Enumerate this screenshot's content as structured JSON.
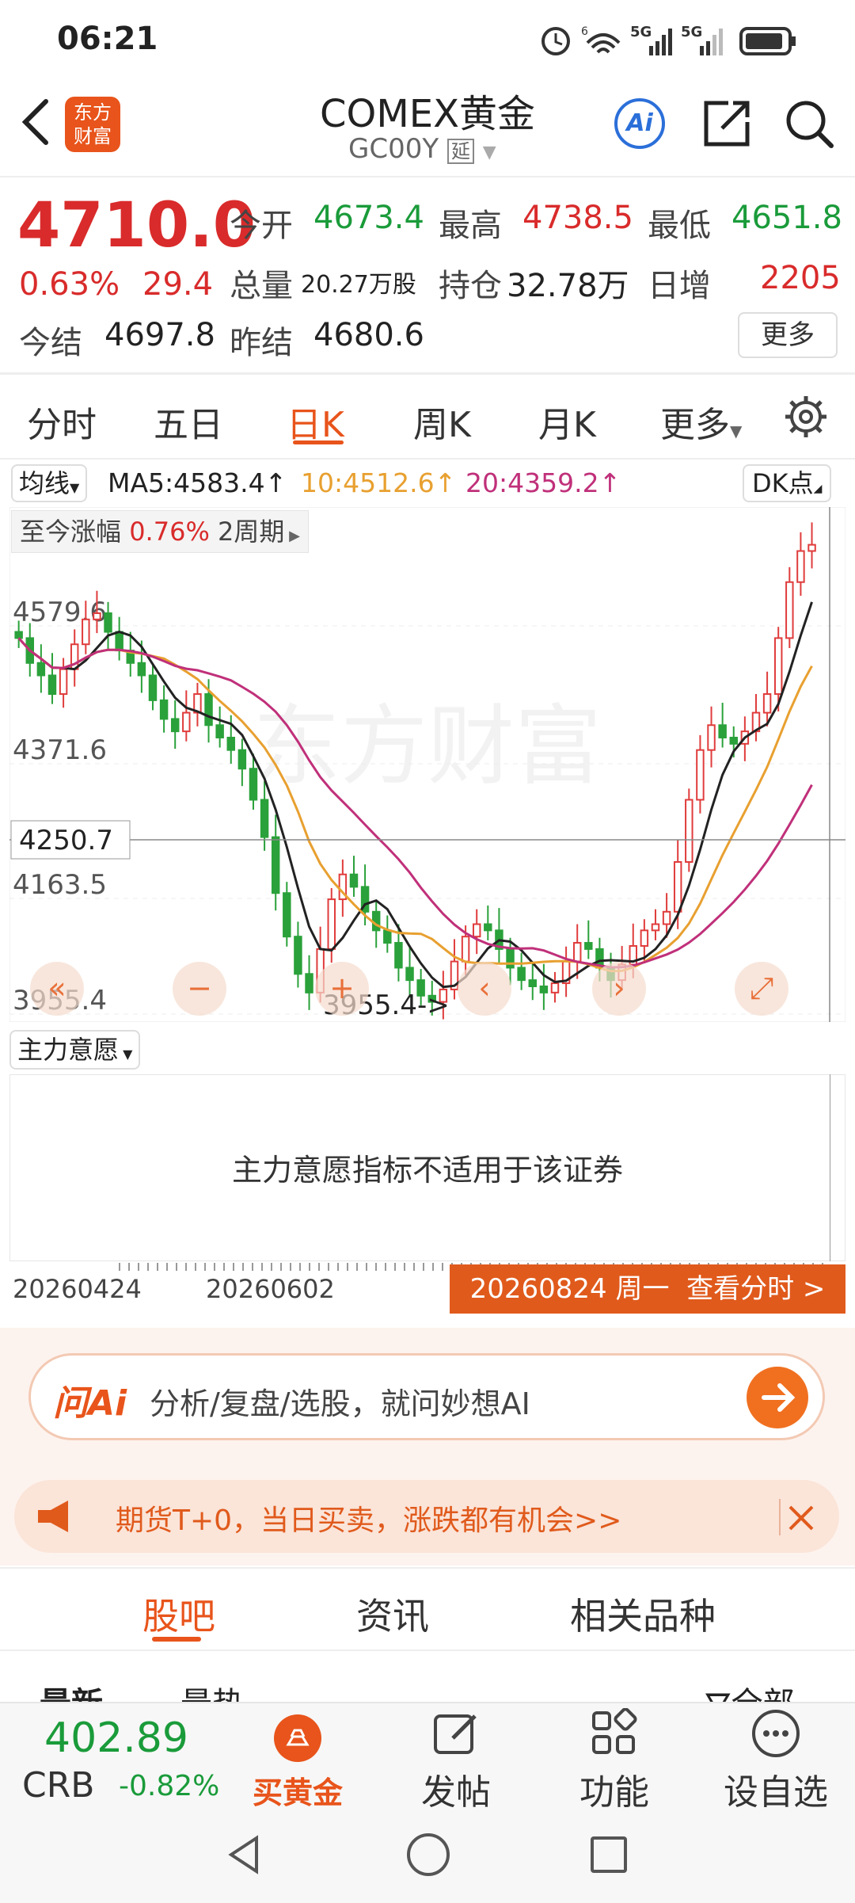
{
  "status": {
    "time": "06:21",
    "net1": "6",
    "net2": "5G",
    "net3": "5G"
  },
  "header": {
    "title": "COMEX黄金",
    "code": "GC00Y",
    "delay_badge": "延",
    "brand_line1": "东方",
    "brand_line2": "财富",
    "ai_label": "Ai"
  },
  "quote": {
    "price": "4710.0",
    "change_pct": "0.63%",
    "change": "29.4",
    "open_label": "今开",
    "open": "4673.4",
    "high_label": "最高",
    "high": "4738.5",
    "low_label": "最低",
    "low": "4651.8",
    "volume_label": "总量",
    "volume": "20.27万股",
    "oi_label": "持仓",
    "oi": "32.78万",
    "dayinc_label": "日增",
    "dayinc": "2205",
    "settle_label": "今结",
    "settle": "4697.8",
    "prev_settle_label": "昨结",
    "prev_settle": "4680.6",
    "more_label": "更多"
  },
  "tabs": [
    "分时",
    "五日",
    "日K",
    "周K",
    "月K",
    "更多"
  ],
  "ma": {
    "label": "均线",
    "ma5": "MA5:4583.4↑",
    "ma10": "10:4512.6↑",
    "ma20": "20:4359.2↑",
    "dk_label": "DK点"
  },
  "range": {
    "label": "至今涨幅",
    "pct": "0.76%",
    "period": "2周期"
  },
  "chart_data": {
    "type": "candlestick",
    "y_ticks": [
      "4579.6",
      "4371.6",
      "4163.5",
      "3955.4"
    ],
    "crosshair_price": "4250.7",
    "low_marker": "3955.4->",
    "x_labels": [
      "20260424",
      "20260602"
    ],
    "watermark": "东方财富",
    "colors": {
      "up": "#e03c3c",
      "down": "#2aa13a",
      "ma5": "#222222",
      "ma10": "#e8a030",
      "ma20": "#c0307a"
    }
  },
  "indicator": {
    "label": "主力意愿",
    "message": "主力意愿指标不适用于该证券"
  },
  "selected_date": "20260824 周一  查看分时 >",
  "ai_search": {
    "brand": "问Ai",
    "placeholder": "分析/复盘/选股，就问妙想AI"
  },
  "promo": {
    "text": "期货T+0，当日买卖，涨跌都有机会>>"
  },
  "sub_tabs": [
    "股吧",
    "资讯",
    "相关品种"
  ],
  "feed_filters": {
    "latest": "最新",
    "hot": "最热",
    "all": "全部"
  },
  "bottom": {
    "index_value": "402.89",
    "index_name": "CRB",
    "index_change": "-0.82%",
    "buy_gold": "买黄金",
    "post": "发帖",
    "function": "功能",
    "watchlist": "设自选"
  }
}
